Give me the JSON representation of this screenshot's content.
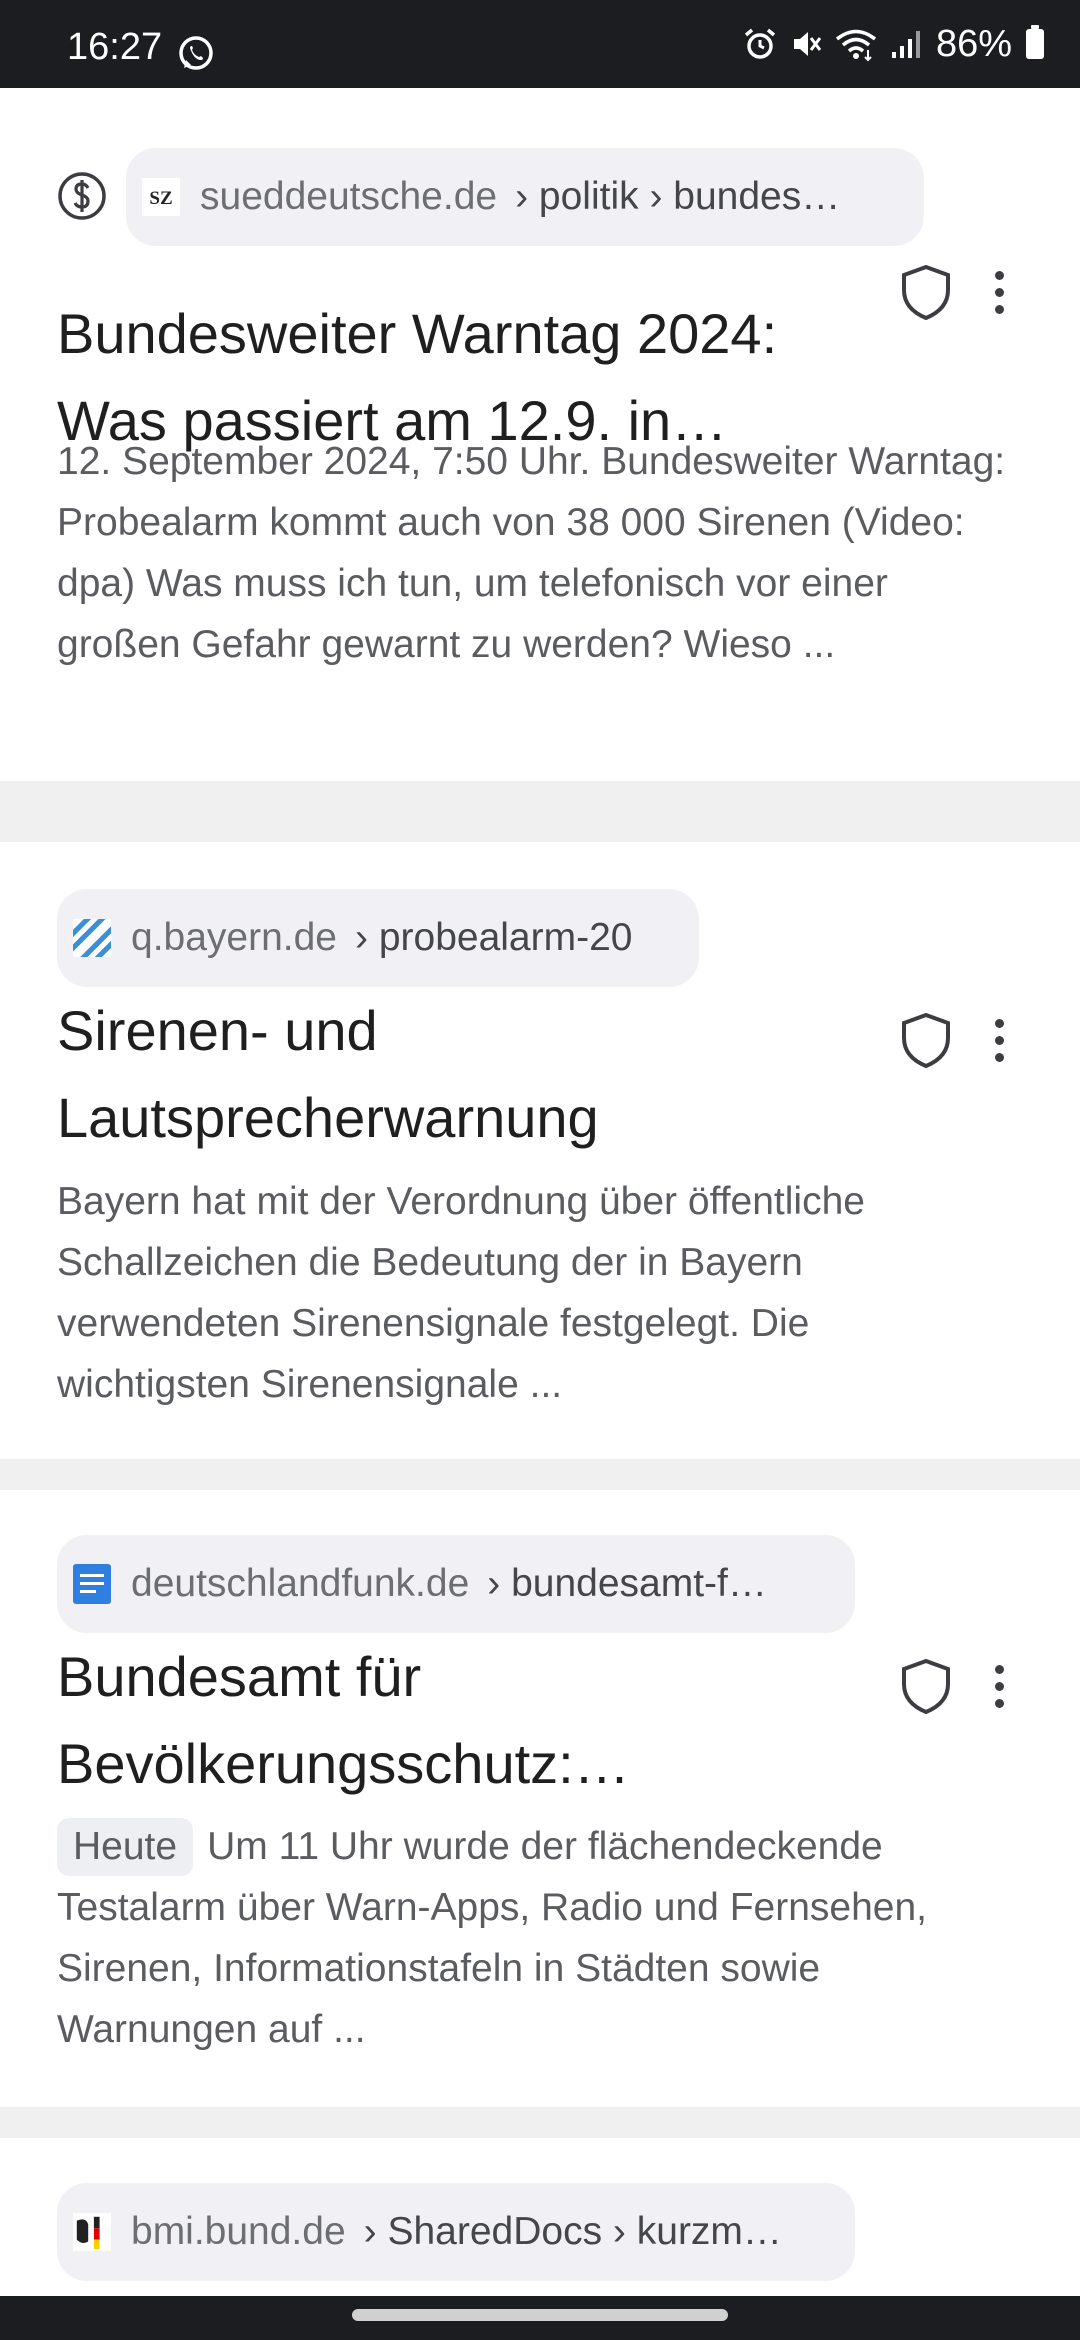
{
  "status_bar": {
    "time": "16:27",
    "battery": "86%"
  },
  "results": [
    {
      "domain": "sueddeutsche.de",
      "path": "› politik › bundes…",
      "favicon": "sz-logo-icon",
      "title": "Bundesweiter Warntag 2024: Was passiert am 12.9. in…",
      "snippet": "12. September 2024, 7:50 Uhr. Bundesweiter Warntag: Probealarm kommt auch von 38 000 Sirenen (Video: dpa) Was muss ich tun, um telefonisch vor einer großen Gefahr gewarnt zu werden? Wieso ...",
      "sponsored_icon": "dollar-circle-icon"
    },
    {
      "domain": "q.bayern.de",
      "path": "› probealarm-20",
      "favicon": "bavaria-flag-icon",
      "title": "Sirenen- und Lautsprecherwarnung",
      "snippet": "Bayern hat mit der Verordnung über öffentliche Schallzeichen die Bedeutung der in Bayern verwendeten Sirenensignale festgelegt. Die wichtigsten Sirenensignale ..."
    },
    {
      "domain": "deutschlandfunk.de",
      "path": "› bundesamt-f…",
      "favicon": "document-icon",
      "title": "Bundesamt für Bevölkerungsschutz:…",
      "badge": "Heute",
      "snippet": "Um 11 Uhr wurde der flächendeckende Testalarm über Warn-Apps, Radio und Fernsehen, Sirenen, Informationstafeln in Städten sowie Warnungen auf ..."
    },
    {
      "domain": "bmi.bund.de",
      "path": "› SharedDocs › kurzm…",
      "favicon": "bundesadler-icon"
    }
  ]
}
